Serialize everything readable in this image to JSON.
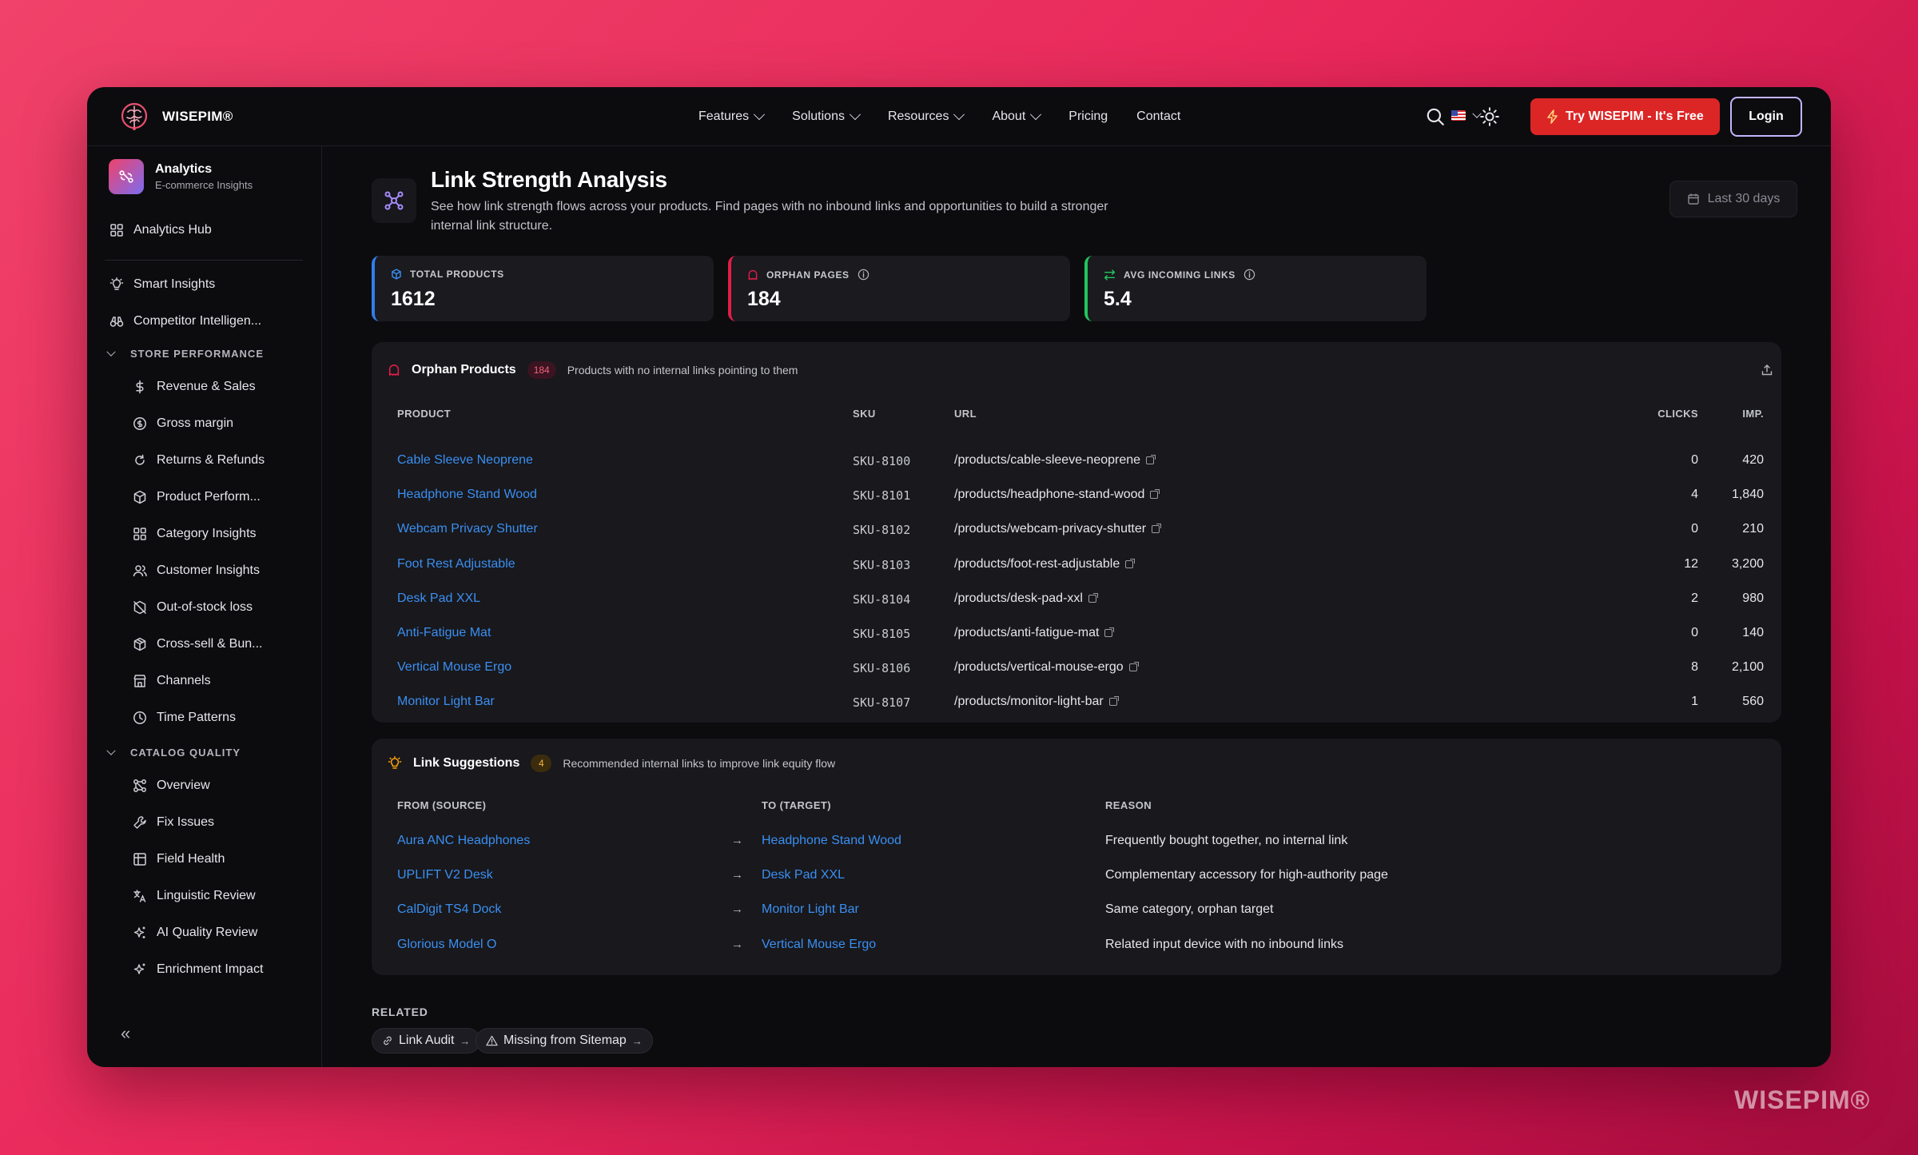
{
  "brand": {
    "name": "WISEPIM®"
  },
  "nav": {
    "links": [
      "Features",
      "Solutions",
      "Resources",
      "About",
      "Pricing",
      "Contact"
    ],
    "try_label": "Try WISEPIM - It's Free",
    "login_label": "Login"
  },
  "sidebar": {
    "header": {
      "title": "Analytics",
      "subtitle": "E-commerce Insights"
    },
    "hub": "Analytics Hub",
    "smart": "Smart Insights",
    "competitor": "Competitor Intelligen...",
    "sections": [
      {
        "label": "STORE PERFORMANCE",
        "items": [
          "Revenue & Sales",
          "Gross margin",
          "Returns & Refunds",
          "Product Perform...",
          "Category Insights",
          "Customer Insights",
          "Out-of-stock loss",
          "Cross-sell & Bun...",
          "Channels",
          "Time Patterns"
        ]
      },
      {
        "label": "CATALOG QUALITY",
        "items": [
          "Overview",
          "Fix Issues",
          "Field Health",
          "Linguistic Review",
          "AI Quality Review",
          "Enrichment Impact"
        ]
      }
    ],
    "collapse": "«"
  },
  "page": {
    "title": "Link Strength Analysis",
    "description": "See how link strength flows across your products. Find pages with no inbound links and opportunities to build a stronger internal link structure.",
    "date_range": "Last 30 days"
  },
  "stats": [
    {
      "label": "TOTAL PRODUCTS",
      "value": "1612",
      "color": "#2f7ee8"
    },
    {
      "label": "ORPHAN PAGES",
      "value": "184",
      "color": "#e11d48"
    },
    {
      "label": "AVG INCOMING LINKS",
      "value": "5.4",
      "color": "#22c55e"
    }
  ],
  "orphans": {
    "title": "Orphan Products",
    "count": "184",
    "note": "Products with no internal links pointing to them",
    "headers": {
      "product": "PRODUCT",
      "sku": "SKU",
      "url": "URL",
      "clicks": "CLICKS",
      "imp": "IMP."
    },
    "rows": [
      {
        "product": "Cable Sleeve Neoprene",
        "sku": "SKU-8100",
        "url": "/products/cable-sleeve-neoprene",
        "clicks": "0",
        "imp": "420"
      },
      {
        "product": "Headphone Stand Wood",
        "sku": "SKU-8101",
        "url": "/products/headphone-stand-wood",
        "clicks": "4",
        "imp": "1,840"
      },
      {
        "product": "Webcam Privacy Shutter",
        "sku": "SKU-8102",
        "url": "/products/webcam-privacy-shutter",
        "clicks": "0",
        "imp": "210"
      },
      {
        "product": "Foot Rest Adjustable",
        "sku": "SKU-8103",
        "url": "/products/foot-rest-adjustable",
        "clicks": "12",
        "imp": "3,200"
      },
      {
        "product": "Desk Pad XXL",
        "sku": "SKU-8104",
        "url": "/products/desk-pad-xxl",
        "clicks": "2",
        "imp": "980"
      },
      {
        "product": "Anti-Fatigue Mat",
        "sku": "SKU-8105",
        "url": "/products/anti-fatigue-mat",
        "clicks": "0",
        "imp": "140"
      },
      {
        "product": "Vertical Mouse Ergo",
        "sku": "SKU-8106",
        "url": "/products/vertical-mouse-ergo",
        "clicks": "8",
        "imp": "2,100"
      },
      {
        "product": "Monitor Light Bar",
        "sku": "SKU-8107",
        "url": "/products/monitor-light-bar",
        "clicks": "1",
        "imp": "560"
      }
    ]
  },
  "suggestions": {
    "title": "Link Suggestions",
    "count": "4",
    "note": "Recommended internal links to improve link equity flow",
    "headers": {
      "from": "FROM (SOURCE)",
      "to": "TO (TARGET)",
      "reason": "REASON"
    },
    "rows": [
      {
        "from": "Aura ANC Headphones",
        "to": "Headphone Stand Wood",
        "reason": "Frequently bought together, no internal link"
      },
      {
        "from": "UPLIFT V2 Desk",
        "to": "Desk Pad XXL",
        "reason": "Complementary accessory for high-authority page"
      },
      {
        "from": "CalDigit TS4 Dock",
        "to": "Monitor Light Bar",
        "reason": "Same category, orphan target"
      },
      {
        "from": "Glorious Model O",
        "to": "Vertical Mouse Ergo",
        "reason": "Related input device with no inbound links"
      }
    ]
  },
  "related": {
    "label": "RELATED",
    "chips": [
      "Link Audit",
      "Missing from Sitemap"
    ]
  },
  "watermark": "WISEPIM®"
}
